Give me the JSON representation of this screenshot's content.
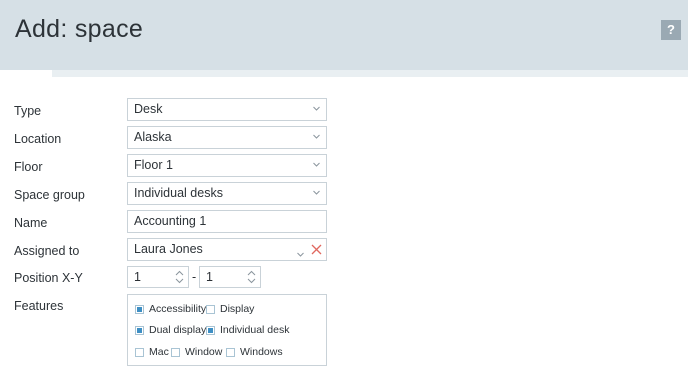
{
  "header": {
    "title": "Add: space",
    "help_label": "?"
  },
  "form": {
    "type": {
      "label": "Type",
      "value": "Desk"
    },
    "location": {
      "label": "Location",
      "value": "Alaska"
    },
    "floor": {
      "label": "Floor",
      "value": "Floor 1"
    },
    "space_group": {
      "label": "Space group",
      "value": "Individual desks"
    },
    "name": {
      "label": "Name",
      "value": "Accounting 1"
    },
    "assigned_to": {
      "label": "Assigned to",
      "value": "Laura Jones"
    },
    "position": {
      "label": "Position X-Y",
      "x": "1",
      "separator": "-",
      "y": "1"
    },
    "features": {
      "label": "Features",
      "options": [
        {
          "label": "Accessibility",
          "checked": true
        },
        {
          "label": "Display",
          "checked": false
        },
        {
          "label": "Dual display",
          "checked": true
        },
        {
          "label": "Individual desk",
          "checked": true
        },
        {
          "label": "Mac",
          "checked": false
        },
        {
          "label": "Window",
          "checked": false
        },
        {
          "label": "Windows",
          "checked": false
        }
      ]
    }
  },
  "colors": {
    "header_bg": "#d6e0e6",
    "accent_check": "#3e8fc4",
    "clear_x": "#e0685f"
  }
}
